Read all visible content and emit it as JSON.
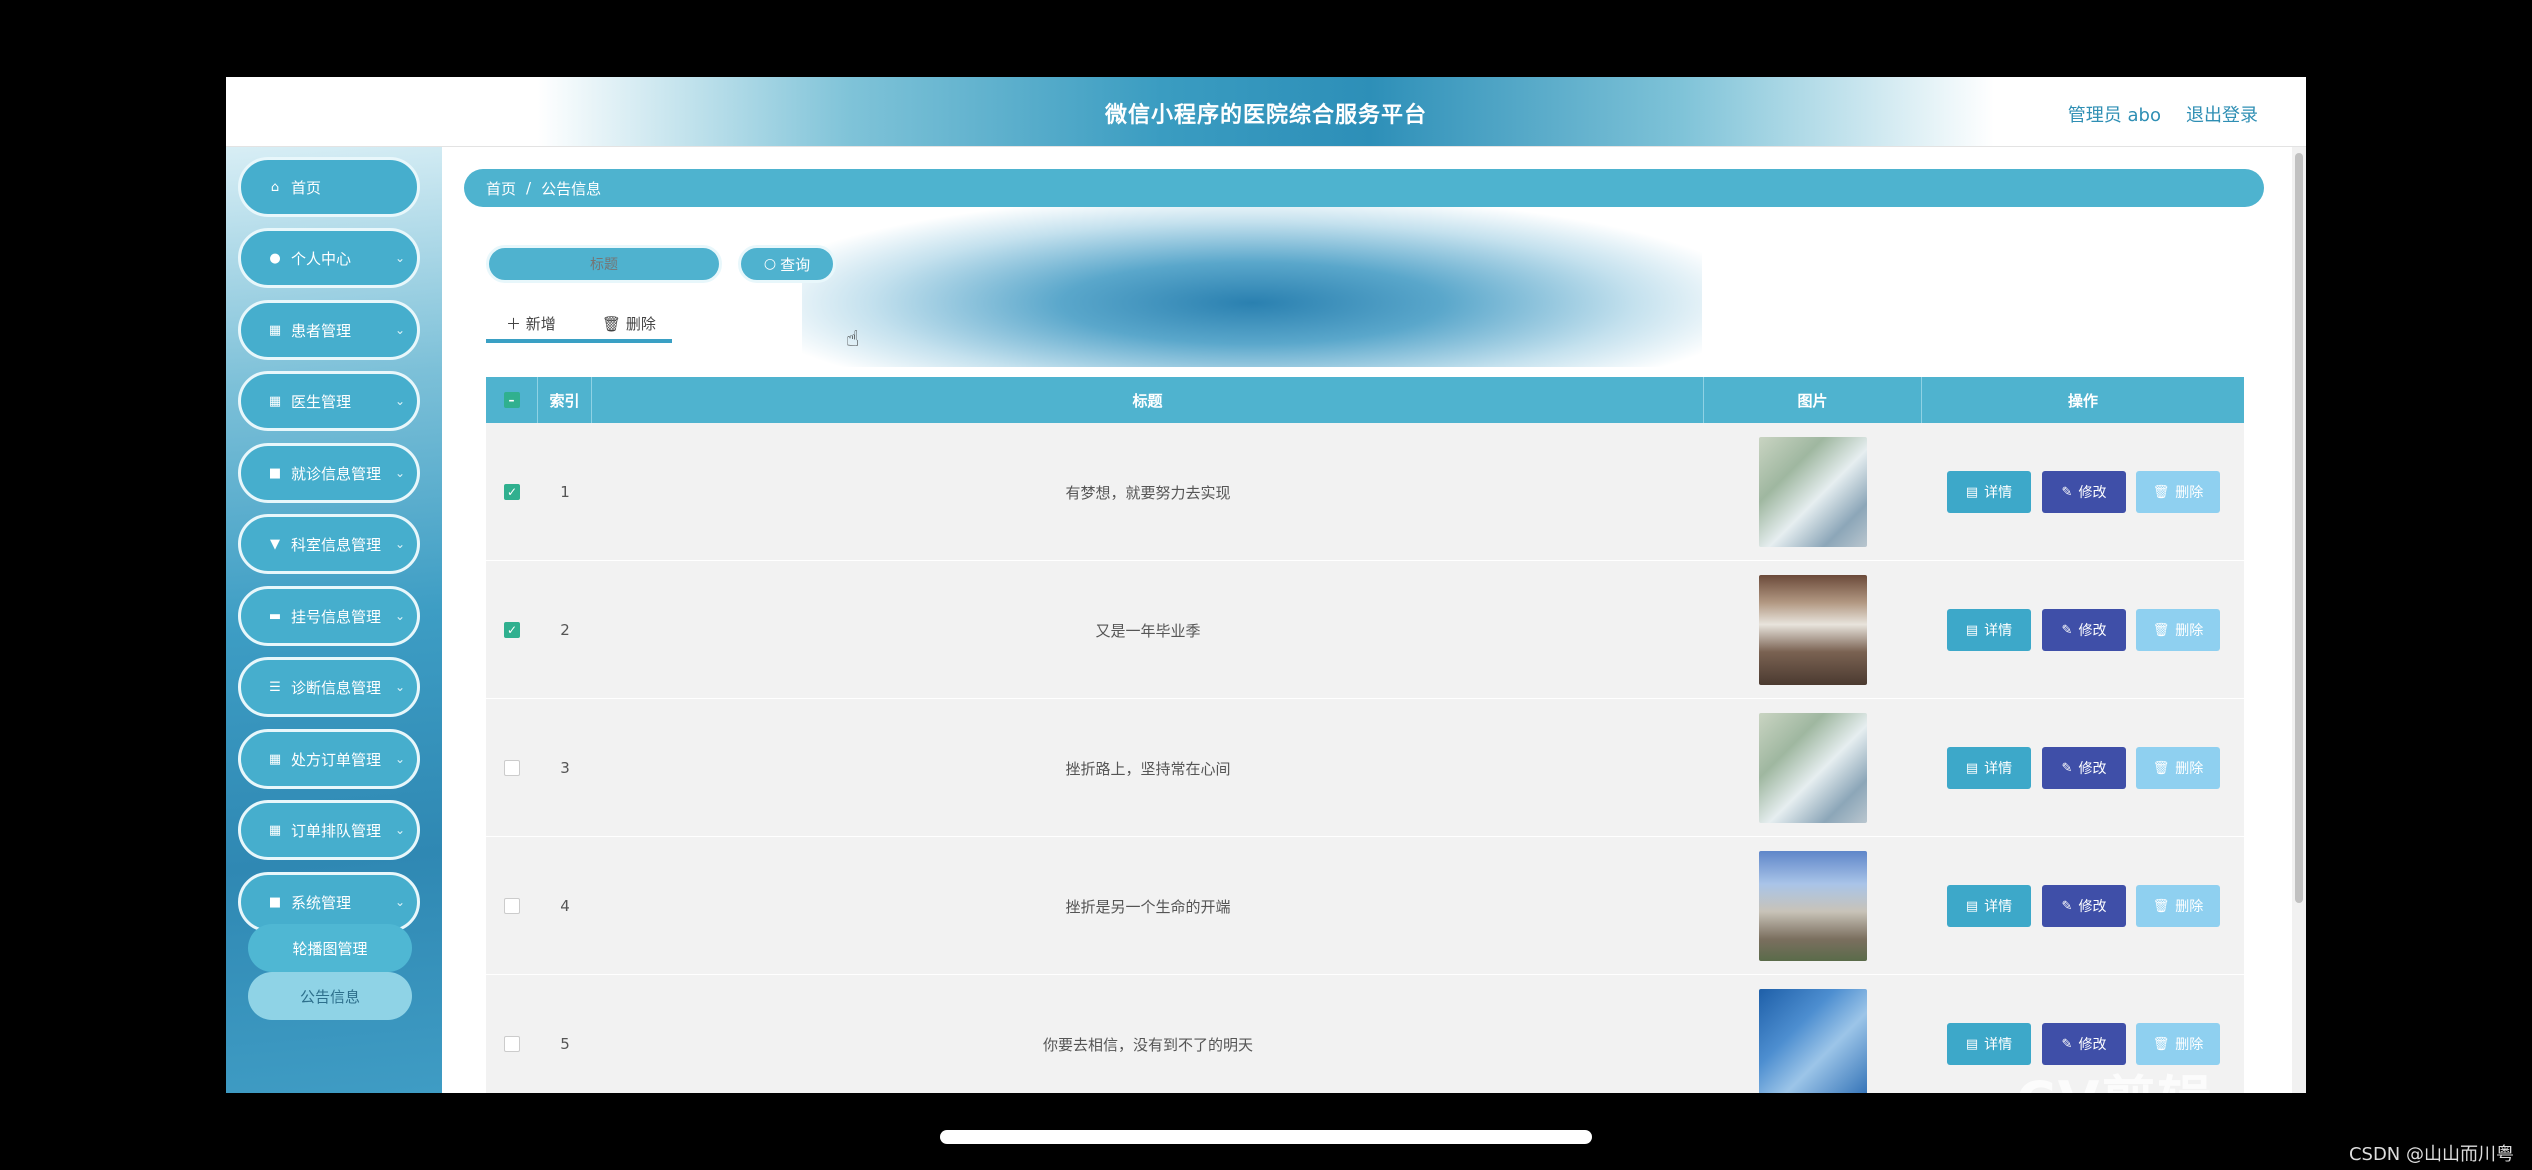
{
  "header": {
    "title": "微信小程序的医院综合服务平台",
    "user": "管理员 abo",
    "logout": "退出登录"
  },
  "sidebar": {
    "items": [
      {
        "label": "首页",
        "icon": "home-icon"
      },
      {
        "label": "个人中心",
        "icon": "user-icon"
      },
      {
        "label": "患者管理",
        "icon": "grid-icon"
      },
      {
        "label": "医生管理",
        "icon": "grid-icon"
      },
      {
        "label": "就诊信息管理",
        "icon": "briefcase-icon"
      },
      {
        "label": "科室信息管理",
        "icon": "trophy-icon"
      },
      {
        "label": "挂号信息管理",
        "icon": "monitor-icon"
      },
      {
        "label": "诊断信息管理",
        "icon": "sliders-icon"
      },
      {
        "label": "处方订单管理",
        "icon": "grid-icon"
      },
      {
        "label": "订单排队管理",
        "icon": "grid-icon"
      },
      {
        "label": "系统管理",
        "icon": "briefcase-icon"
      }
    ],
    "submenu": [
      "轮播图管理",
      "公告信息"
    ]
  },
  "breadcrumb": {
    "home": "首页",
    "sep": "/",
    "current": "公告信息"
  },
  "search": {
    "placeholder": "标题",
    "button": "查询"
  },
  "toolbar": {
    "add": "新增",
    "delete": "删除"
  },
  "table": {
    "headers": {
      "index": "索引",
      "title": "标题",
      "image": "图片",
      "actions": "操作"
    },
    "actions": {
      "detail": "详情",
      "edit": "修改",
      "delete": "删除"
    },
    "rows": [
      {
        "index": "1",
        "title": "有梦想，就要努力去实现",
        "checked": true
      },
      {
        "index": "2",
        "title": "又是一年毕业季",
        "checked": true
      },
      {
        "index": "3",
        "title": "挫折路上，坚持常在心间",
        "checked": false
      },
      {
        "index": "4",
        "title": "挫折是另一个生命的开端",
        "checked": false
      },
      {
        "index": "5",
        "title": "你要去相信，没有到不了的明天",
        "checked": false
      }
    ]
  },
  "overlay": {
    "credit": "CSDN @山山而川粤",
    "watermark": "CV剪辑"
  },
  "colors": {
    "accent": "#4fb3cf",
    "edit": "#3f4fa8",
    "delete": "#8fd0f0",
    "checkbox": "#30b08f"
  }
}
